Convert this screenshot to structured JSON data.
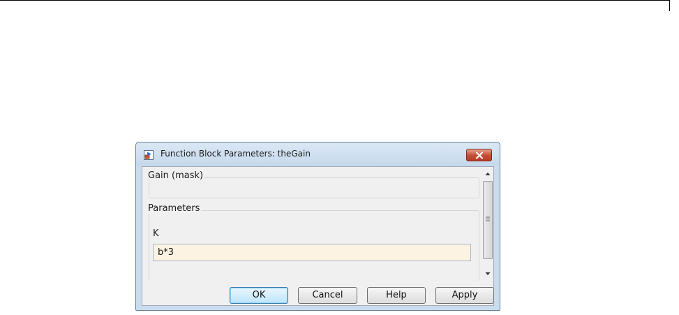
{
  "dialog": {
    "title": "Function Block Parameters: theGain",
    "icons": {
      "app": "simulink-block-icon",
      "close": "close-icon"
    },
    "mask_group": {
      "label": "Gain (mask)"
    },
    "parameters_group": {
      "label": "Parameters",
      "field_label": "K",
      "field_value": "b*3"
    },
    "buttons": {
      "ok": "OK",
      "cancel": "Cancel",
      "help": "Help",
      "apply": "Apply"
    },
    "colors": {
      "input_background": "#fdf3e2",
      "close_button": "#c9503a"
    }
  }
}
